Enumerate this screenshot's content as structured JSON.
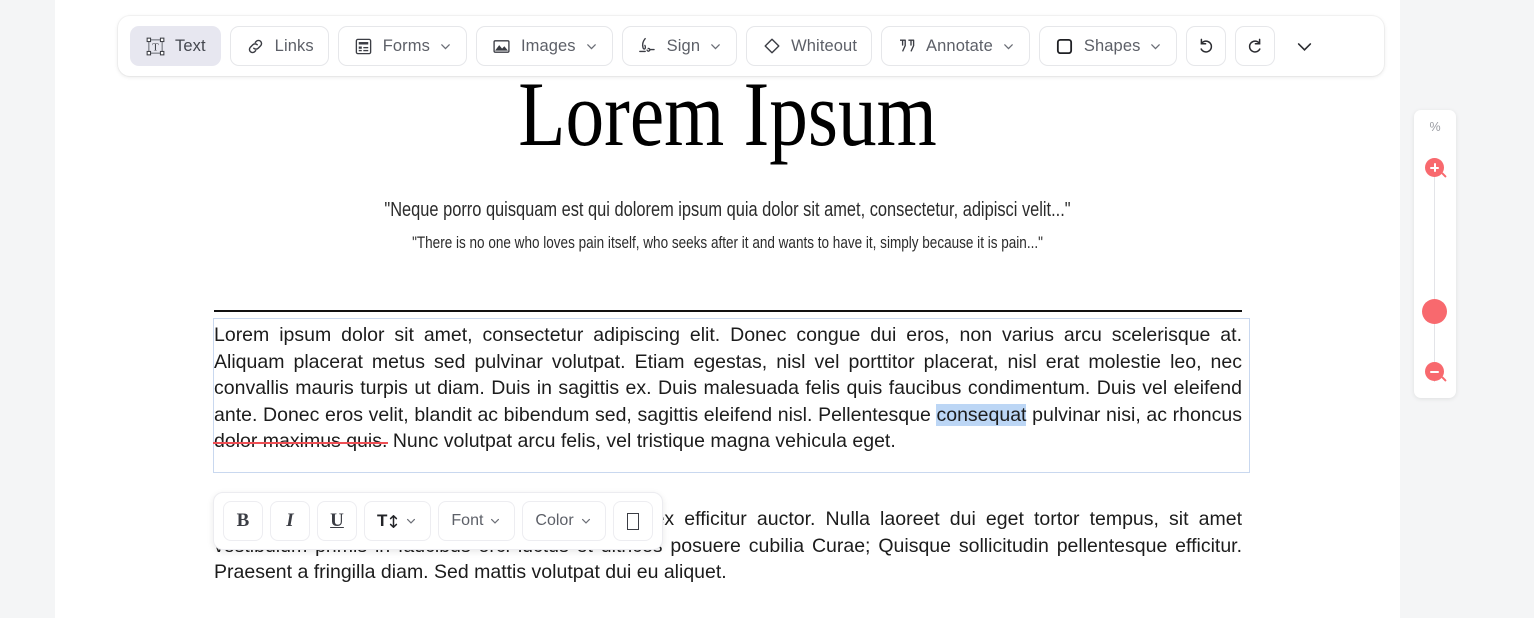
{
  "app": {
    "background_color": "#f4f5f6",
    "page_color": "#ffffff"
  },
  "toolbar": {
    "items": [
      {
        "id": "text",
        "label": "Text",
        "icon": "text-box-icon",
        "has_caret": false,
        "active": true
      },
      {
        "id": "links",
        "label": "Links",
        "icon": "link-icon",
        "has_caret": false,
        "active": false
      },
      {
        "id": "forms",
        "label": "Forms",
        "icon": "form-icon",
        "has_caret": true,
        "active": false
      },
      {
        "id": "images",
        "label": "Images",
        "icon": "image-icon",
        "has_caret": true,
        "active": false
      },
      {
        "id": "sign",
        "label": "Sign",
        "icon": "signature-icon",
        "has_caret": true,
        "active": false
      },
      {
        "id": "whiteout",
        "label": "Whiteout",
        "icon": "eraser-icon",
        "has_caret": false,
        "active": false
      },
      {
        "id": "annotate",
        "label": "Annotate",
        "icon": "quote-marks-icon",
        "has_caret": true,
        "active": false
      },
      {
        "id": "shapes",
        "label": "Shapes",
        "icon": "square-icon",
        "has_caret": true,
        "active": false
      }
    ],
    "undo_icon": "undo-icon",
    "redo_icon": "redo-icon",
    "more_icon": "chevron-down-icon",
    "active_bg": "#e7e7f0"
  },
  "document": {
    "title": "Lorem Ipsum",
    "quote_latin": "\"Neque porro quisquam est qui dolorem ipsum quia dolor sit amet, consectetur, adipisci velit...\"",
    "quote_english": "\"There is no one who loves pain itself, who seeks after it and wants to have it, simply because it is pain...\"",
    "paragraph_1": {
      "before_selection": "Lorem ipsum dolor sit amet, consectetur adipiscing elit. Donec congue dui eros, non varius arcu scelerisque at. Aliquam placerat metus sed pulvinar volutpat. Etiam egestas, nisl vel porttitor placerat, nisl erat molestie leo, nec convallis mauris turpis ut diam. Duis in sagittis ex. Duis malesuada felis quis faucibus condimentum. Duis vel eleifend ante. Donec eros velit, blandit ac bibendum sed, sagittis eleifend nisl. Pellentesque ",
      "selected_text": "consequat",
      "between": " pulvinar nisi, ac rhoncus ",
      "struck_text": "dolor maximus quis.",
      "after_struck": " Nunc volutpat arcu felis, vel tristique magna vehicula eget."
    },
    "paragraph_2": {
      "line_1": "Nulla a ante sed lorem condimentum sapien a ex efficitur auctor. Nulla laoreet dui",
      "line_2": "eget tortor tempus, sit amet vestibulum primis in faucibus orci luctus et ultrices posuere",
      "line_3": "cubilia Curae; Quisque sollicitudin pellentesque efficitur. Praesent a fringilla diam. Sed mattis volutpat",
      "line_4": "dui eu aliquet."
    },
    "selection_highlight_color": "#bcd6f5",
    "strikethrough_color": "#ef4f54",
    "textbox_border_color": "#c9d8ef"
  },
  "format_bar": {
    "bold_label": "B",
    "italic_label": "I",
    "underline_label": "U",
    "text_size_label": "T",
    "font_label": "Font",
    "color_label": "Color",
    "last_button_label": "□"
  },
  "zoom_panel": {
    "percent_label": "%",
    "zoom_in_icon": "zoom-in-icon",
    "zoom_out_icon": "zoom-out-icon",
    "handle_icon": "slider-handle",
    "accent_color": "#f8696e"
  }
}
